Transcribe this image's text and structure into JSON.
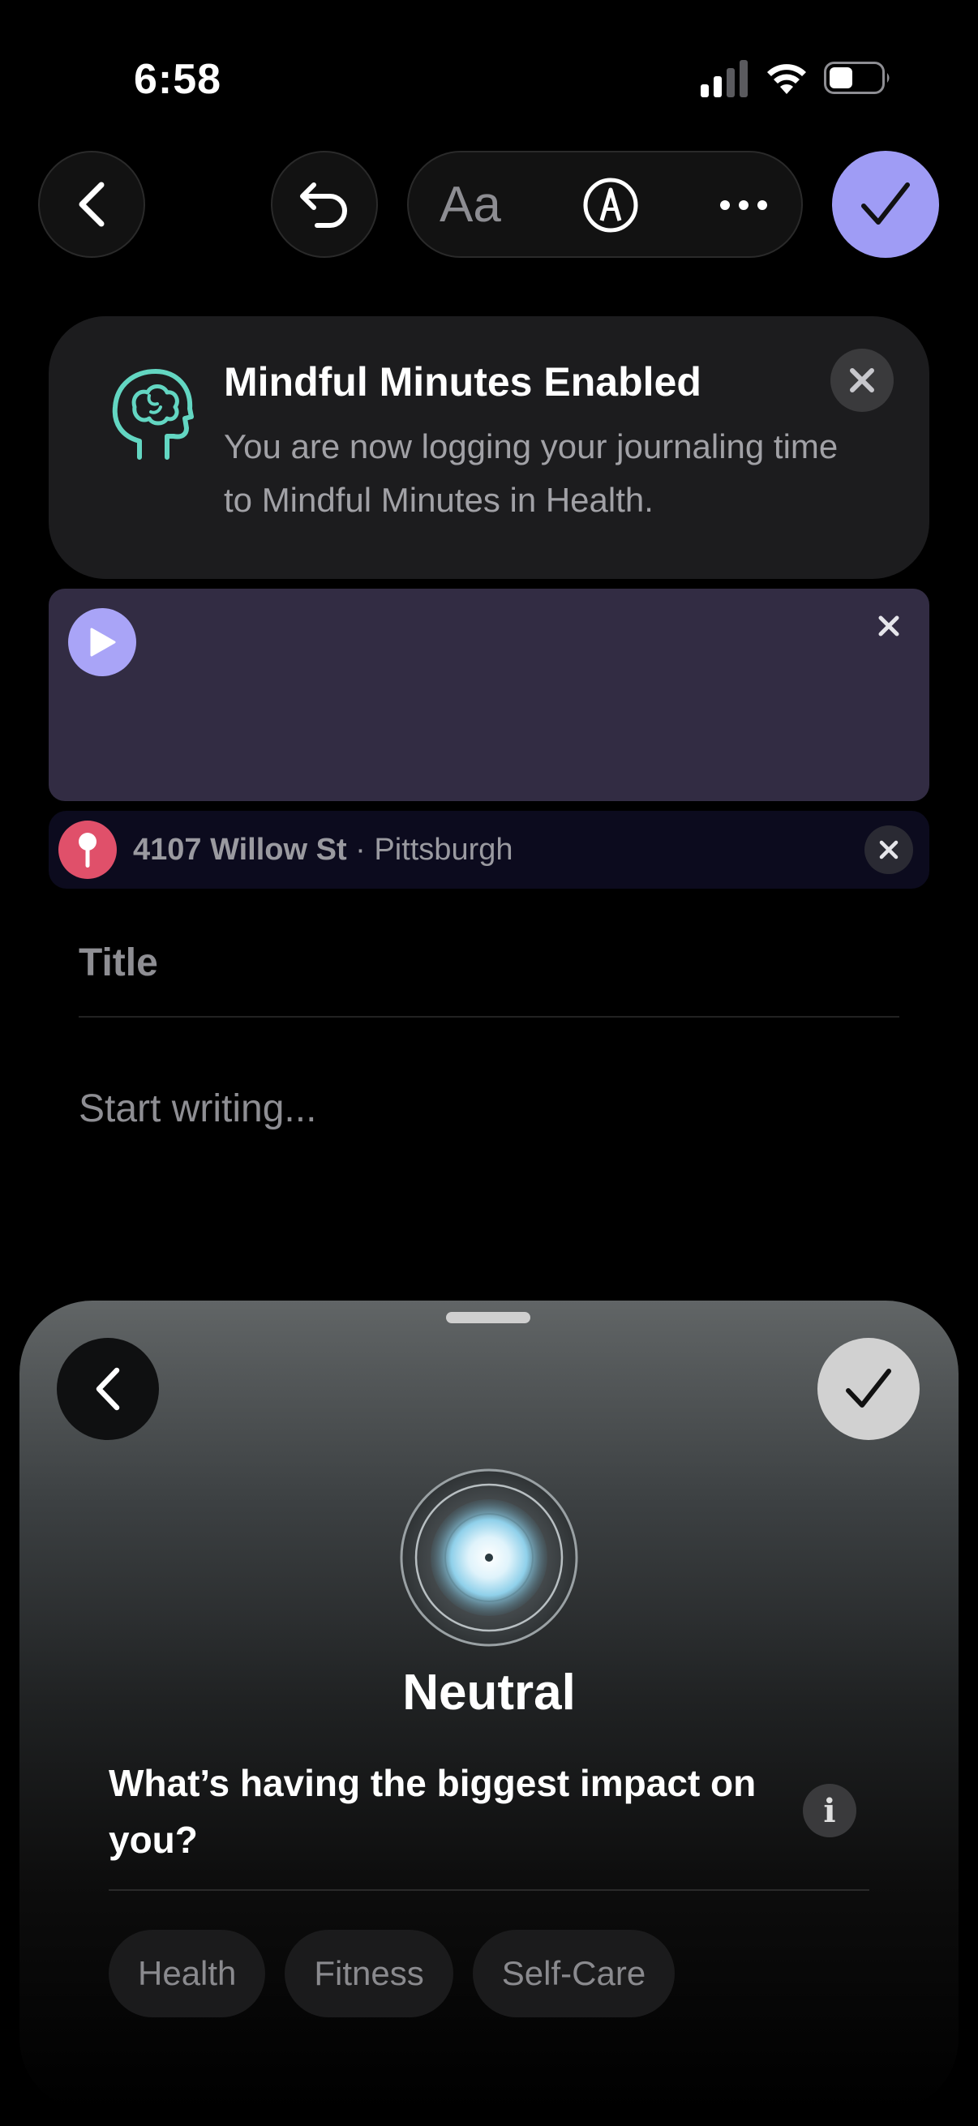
{
  "status_bar": {
    "time": "6:58"
  },
  "toolbar": {
    "format_label": "Aa"
  },
  "banner": {
    "title": "Mindful Minutes Enabled",
    "message": "You are now logging your journaling time to Mindful Minutes in Health.",
    "icon_color": "#63d6c2"
  },
  "location": {
    "street": "4107 Willow St",
    "separator": " · ",
    "city": "Pittsburgh"
  },
  "entry": {
    "title_placeholder": "Title",
    "body_placeholder": "Start writing..."
  },
  "mood_sheet": {
    "mood": "Neutral",
    "question": "What’s having the biggest impact on you?",
    "info_glyph": "i",
    "chips": [
      "Health",
      "Fitness",
      "Self-Care"
    ]
  },
  "colors": {
    "accent": "#9f9cf5",
    "audio_bg": "#322c43",
    "pin": "#e0506a"
  }
}
